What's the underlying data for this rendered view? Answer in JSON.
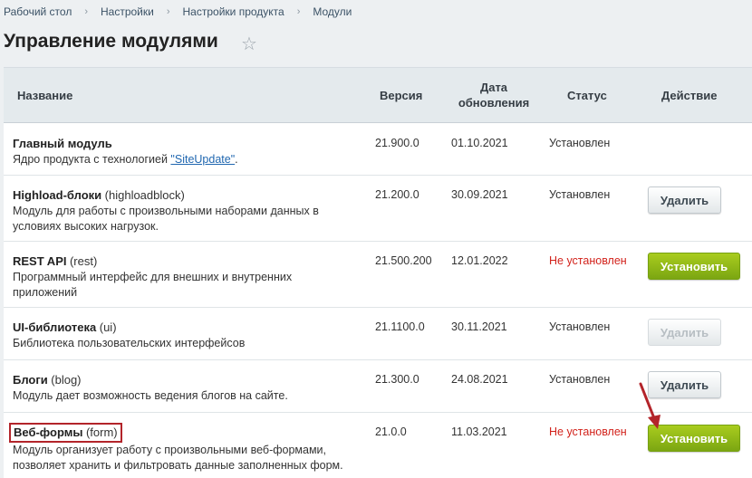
{
  "breadcrumbs": [
    "Рабочий стол",
    "Настройки",
    "Настройки продукта",
    "Модули"
  ],
  "page_title": "Управление модулями",
  "icons": {
    "favorite": "star-icon",
    "separator": "chevron-right-icon",
    "pointer": "arrow-icon"
  },
  "table": {
    "headers": {
      "name": "Название",
      "version": "Версия",
      "date": "Дата обновления",
      "status": "Статус",
      "action": "Действие"
    },
    "rows": [
      {
        "title": "Главный модуль",
        "code": "",
        "desc": "Ядро продукта с технологией",
        "link": "\"SiteUpdate\"",
        "desc_end": ".",
        "version": "21.900.0",
        "date": "01.10.2021",
        "status": "Установлен",
        "action": ""
      },
      {
        "title": "Highload-блоки",
        "code": "(highloadblock)",
        "desc": "Модуль для работы с произвольными наборами данных в условиях высоких нагрузок.",
        "version": "21.200.0",
        "date": "30.09.2021",
        "status": "Установлен",
        "action": "Удалить"
      },
      {
        "title": "REST API",
        "code": "(rest)",
        "desc": "Программный интерфейс для внешних и внутренних приложений",
        "version": "21.500.200",
        "date": "12.01.2022",
        "status": "Не установлен",
        "action": "Установить"
      },
      {
        "title": "UI-библиотека",
        "code": "(ui)",
        "desc": "Библиотека пользовательских интерфейсов",
        "version": "21.1100.0",
        "date": "30.11.2021",
        "status": "Установлен",
        "action": "Удалить"
      },
      {
        "title": "Блоги",
        "code": "(blog)",
        "desc": "Модуль дает возможность ведения блогов на сайте.",
        "version": "21.300.0",
        "date": "24.08.2021",
        "status": "Установлен",
        "action": "Удалить"
      },
      {
        "title": "Веб-формы",
        "code": "(form)",
        "desc": "Модуль организует работу с произвольными веб-формами, позволяет хранить и фильтровать данные заполненных форм.",
        "version": "21.0.0",
        "date": "11.03.2021",
        "status": "Не установлен",
        "action": "Установить"
      }
    ]
  },
  "colors": {
    "status_not_installed": "#d2221b",
    "install_button": "#8cb81a",
    "highlight_box": "#b3242a",
    "arrow": "#b3242a"
  }
}
